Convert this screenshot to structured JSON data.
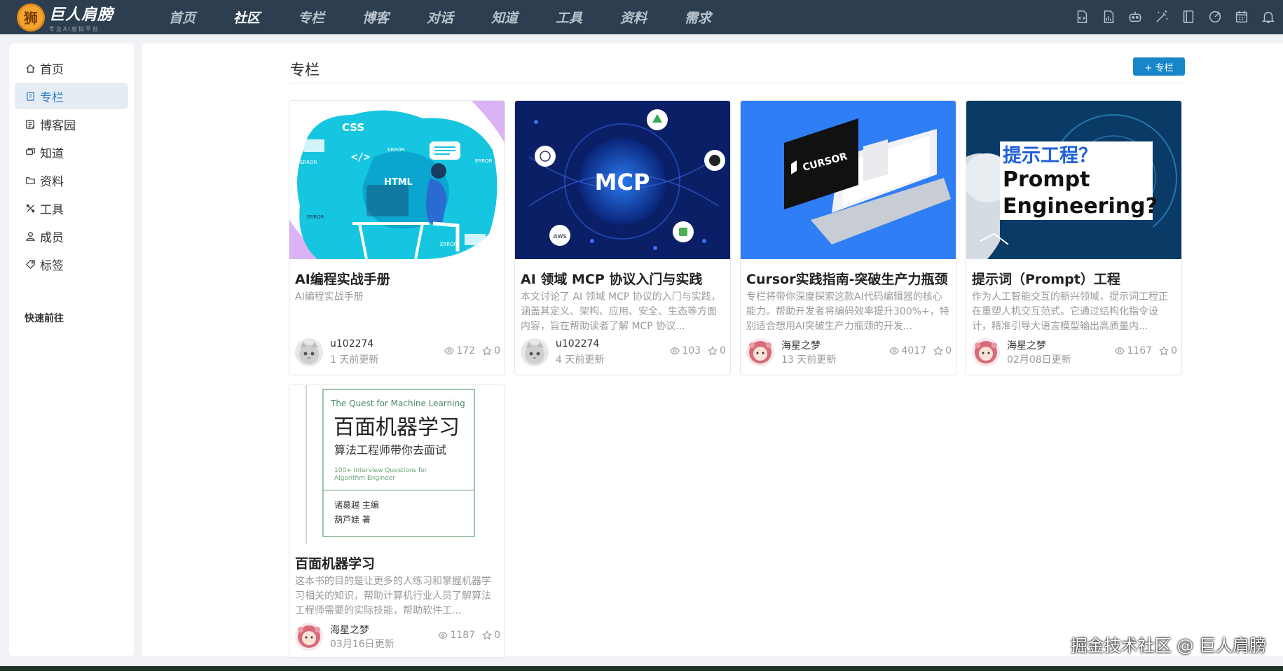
{
  "brand": {
    "name": "巨人肩膀",
    "tagline": "专业AI虚拟平台"
  },
  "nav": [
    {
      "label": "首页",
      "active": false
    },
    {
      "label": "社区",
      "active": true
    },
    {
      "label": "专栏",
      "active": false
    },
    {
      "label": "博客",
      "active": false
    },
    {
      "label": "对话",
      "active": false
    },
    {
      "label": "知道",
      "active": false
    },
    {
      "label": "工具",
      "active": false
    },
    {
      "label": "资料",
      "active": false
    },
    {
      "label": "需求",
      "active": false
    }
  ],
  "top_icons": [
    "code-file-icon",
    "chart-file-icon",
    "robot-icon",
    "magic-wand-icon",
    "book-icon",
    "gauge-icon",
    "calendar-icon",
    "bell-icon"
  ],
  "sidebar": {
    "items": [
      {
        "label": "首页",
        "icon": "home-icon"
      },
      {
        "label": "专栏",
        "icon": "column-icon",
        "active": true
      },
      {
        "label": "博客园",
        "icon": "blog-icon"
      },
      {
        "label": "知道",
        "icon": "qa-icon"
      },
      {
        "label": "资料",
        "icon": "folder-icon"
      },
      {
        "label": "工具",
        "icon": "tools-icon"
      },
      {
        "label": "成员",
        "icon": "user-icon"
      },
      {
        "label": "标签",
        "icon": "tag-icon"
      }
    ],
    "section_title": "快速前往"
  },
  "main": {
    "title": "专栏",
    "add_button": "+ 专栏",
    "cards": [
      {
        "title": "AI编程实战手册",
        "desc": "AI编程实战手册",
        "author": "u102274",
        "updated": "1 天前更新",
        "views": "172",
        "stars": "0",
        "cover": "html-css-cover",
        "cover_text": [
          "CSS",
          "</>",
          "HTML",
          "ERROR",
          "ERROR",
          "ERROR",
          "ERROR",
          "ERROR"
        ]
      },
      {
        "title": "AI 领域 MCP 协议入门与实践",
        "desc": "本文讨论了 AI 领域 MCP 协议的入门与实践，涵盖其定义、架构、应用、安全、生态等方面内容，旨在帮助读者了解 MCP 协议...",
        "author": "u102274",
        "updated": "4 天前更新",
        "views": "103",
        "stars": "0",
        "cover": "mcp-cover",
        "cover_text": [
          "MCP",
          "aws"
        ]
      },
      {
        "title": "Cursor实践指南-突破生产力瓶颈",
        "desc": "专栏将带你深度探索这款AI代码编辑器的核心能力。帮助开发者将编码效率提升300%+，特别适合想用AI突破生产力瓶颈的开发...",
        "author": "海星之梦",
        "updated": "13 天前更新",
        "views": "4017",
        "stars": "0",
        "cover": "cursor-cover",
        "cover_text": [
          "CURSOR"
        ]
      },
      {
        "title": "提示词（Prompt）工程",
        "desc": "作为人工智能交互的新兴领域，提示词工程正在重塑人机交互范式。它通过结构化指令设计，精准引导大语言模型输出高质量内...",
        "author": "海星之梦",
        "updated": "02月08日更新",
        "views": "1167",
        "stars": "0",
        "cover": "prompt-cover",
        "cover_text": [
          "提示工程？",
          "Prompt",
          "Engineering?"
        ]
      },
      {
        "title": "百面机器学习",
        "desc": "这本书的目的是让更多的人练习和掌握机器学习相关的知识，帮助计算机行业人员了解算法工程师需要的实际技能，帮助软件工...",
        "author": "海星之梦",
        "updated": "03月16日更新",
        "views": "1187",
        "stars": "0",
        "cover": "book-cover",
        "cover_text": [
          "The Quest for Machine Learning",
          "百面机器学习",
          "算法工程师带你去面试",
          "100+ Interview Questions for",
          "Algorithm Engineer",
          "诸葛越  主编",
          "葫芦娃  著"
        ]
      }
    ]
  },
  "watermark": "掘金技术社区 @ 巨人肩膀",
  "colors": {
    "topbar": "#2c3e50",
    "accent": "#1786c8",
    "active_bg": "#e6ecf3"
  }
}
